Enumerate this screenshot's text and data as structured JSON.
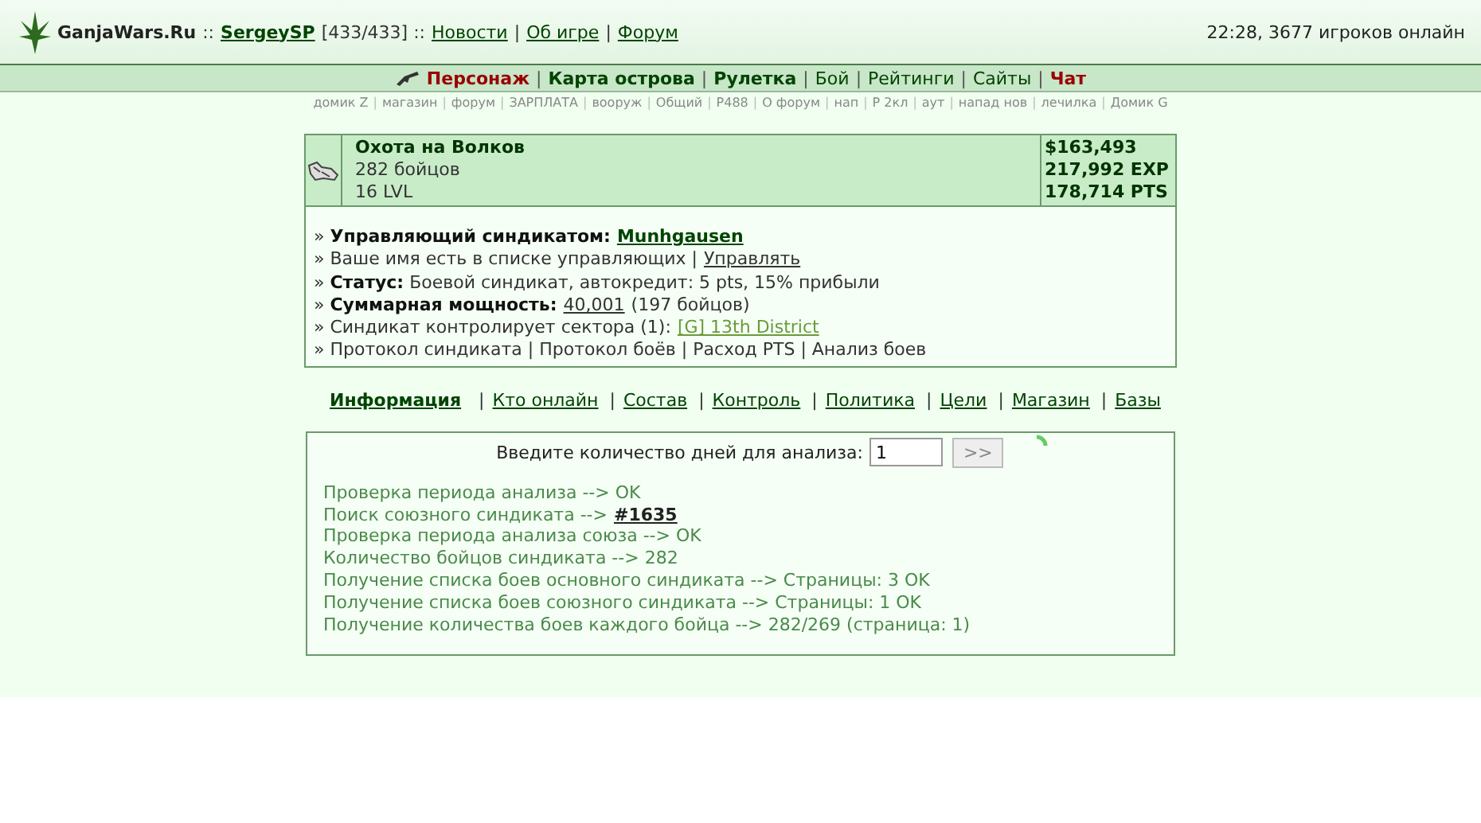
{
  "header": {
    "brand": "GanjaWars.Ru",
    "segments": [
      {
        "kind": "text",
        "text": "::"
      },
      {
        "kind": "user",
        "text": "SergeySP"
      },
      {
        "kind": "text",
        "text": "[433/433] ::"
      },
      {
        "kind": "link",
        "text": "Новости"
      },
      {
        "kind": "text",
        "text": "|"
      },
      {
        "kind": "link",
        "text": "Об игре"
      },
      {
        "kind": "text",
        "text": "|"
      },
      {
        "kind": "link",
        "text": "Форум"
      }
    ],
    "status": "22:28, 3677 игроков онлайн"
  },
  "main_menu": [
    {
      "kind": "accent",
      "text": "Персонаж"
    },
    {
      "kind": "sep",
      "text": "|"
    },
    {
      "kind": "bold",
      "text": "Карта острова"
    },
    {
      "kind": "sep",
      "text": "|"
    },
    {
      "kind": "bold",
      "text": "Рулетка"
    },
    {
      "kind": "sep",
      "text": "|"
    },
    {
      "kind": "plain",
      "text": "Бой"
    },
    {
      "kind": "sep",
      "text": "|"
    },
    {
      "kind": "plain",
      "text": "Рейтинги"
    },
    {
      "kind": "sep",
      "text": "|"
    },
    {
      "kind": "plain",
      "text": "Сайты"
    },
    {
      "kind": "sep",
      "text": "|"
    },
    {
      "kind": "accent",
      "text": "Чат"
    }
  ],
  "sub_menu": [
    {
      "kind": "link",
      "text": "домик Z"
    },
    {
      "kind": "sep",
      "text": "|"
    },
    {
      "kind": "link",
      "text": "магазин"
    },
    {
      "kind": "sep",
      "text": "|"
    },
    {
      "kind": "link",
      "text": "форум"
    },
    {
      "kind": "sep",
      "text": "|"
    },
    {
      "kind": "link",
      "text": "ЗАРПЛАТА"
    },
    {
      "kind": "sep",
      "text": "|"
    },
    {
      "kind": "link",
      "text": "вооруж"
    },
    {
      "kind": "sep",
      "text": "|"
    },
    {
      "kind": "link",
      "text": "Общий"
    },
    {
      "kind": "sep",
      "text": "|"
    },
    {
      "kind": "link",
      "text": "P488"
    },
    {
      "kind": "sep",
      "text": "|"
    },
    {
      "kind": "link",
      "text": "О форум"
    },
    {
      "kind": "sep",
      "text": "|"
    },
    {
      "kind": "link",
      "text": "нап"
    },
    {
      "kind": "sep",
      "text": "|"
    },
    {
      "kind": "link",
      "text": "Р 2кл"
    },
    {
      "kind": "sep",
      "text": "|"
    },
    {
      "kind": "link",
      "text": "аут"
    },
    {
      "kind": "sep",
      "text": "|"
    },
    {
      "kind": "link",
      "text": "напад нов"
    },
    {
      "kind": "sep",
      "text": "|"
    },
    {
      "kind": "link",
      "text": "лечилка"
    },
    {
      "kind": "sep",
      "text": "|"
    },
    {
      "kind": "link",
      "text": "Домик G"
    }
  ],
  "syndicate": {
    "name": "Охота на Волков",
    "fighters": "282 бойцов",
    "level": "16 LVL",
    "stats": [
      "$163,493",
      "217,992 EXP",
      "178,714 PTS"
    ],
    "lines": [
      {
        "parts": [
          {
            "kind": "text",
            "text": "» **Управляющий синдикатом:**"
          },
          {
            "kind": "strong-link",
            "text": "Munhgausen"
          }
        ]
      },
      {
        "parts": [
          {
            "kind": "text",
            "text": "» Ваше имя есть в списке управляющих |"
          },
          {
            "kind": "link",
            "text": "Управлять"
          }
        ]
      },
      {
        "parts": [
          {
            "kind": "text",
            "text": "» **Статус:** Боевой синдикат, автокредит: 5 pts, 15% прибыли"
          }
        ]
      },
      {
        "parts": [
          {
            "kind": "text",
            "text": "» **Суммарная мощность:**"
          },
          {
            "kind": "link",
            "text": "40,001"
          },
          {
            "kind": "text",
            "text": "(197 бойцов)"
          }
        ]
      },
      {
        "parts": [
          {
            "kind": "text",
            "text": "» Синдикат контролирует сектора (1):"
          },
          {
            "kind": "sector-link",
            "text": "[G] 13th District"
          }
        ]
      },
      {
        "parts": [
          {
            "kind": "text",
            "text": "» Протокол синдиката | Протокол боёв | Расход PTS | Анализ боев"
          }
        ]
      }
    ]
  },
  "tabs": [
    {
      "label": "Информация",
      "selected": true
    },
    {
      "label": "Кто онлайн",
      "selected": false
    },
    {
      "label": "Состав",
      "selected": false
    },
    {
      "label": "Контроль",
      "selected": false
    },
    {
      "label": "Политика",
      "selected": false
    },
    {
      "label": "Цели",
      "selected": false
    },
    {
      "label": "Магазин",
      "selected": false
    },
    {
      "label": "Базы",
      "selected": false
    }
  ],
  "tab_separator": "|",
  "analysis": {
    "prompt": "Введите количество дней для анализа:",
    "days_value": "1",
    "submit": ">>",
    "loading": true,
    "log": [
      {
        "parts": [
          {
            "kind": "text",
            "text": "Проверка периода анализа --> OK"
          }
        ]
      },
      {
        "parts": [
          {
            "kind": "text",
            "text": "Поиск союзного синдиката -->"
          },
          {
            "kind": "link",
            "text": "#1635"
          }
        ]
      },
      {
        "parts": [
          {
            "kind": "text",
            "text": "Проверка периода анализа союза --> OK"
          }
        ]
      },
      {
        "parts": [
          {
            "kind": "text",
            "text": "Количество бойцов синдиката --> 282"
          }
        ]
      },
      {
        "parts": [
          {
            "kind": "text",
            "text": "Получение списка боев основного синдиката --> Страницы: 3 OK"
          }
        ]
      },
      {
        "parts": [
          {
            "kind": "text",
            "text": "Получение списка боев союзного синдиката --> Страницы: 1 OK"
          }
        ]
      },
      {
        "parts": [
          {
            "kind": "text",
            "text": "Получение количества боев каждого бойца --> 282/269 (страница: 1)"
          }
        ]
      }
    ]
  }
}
